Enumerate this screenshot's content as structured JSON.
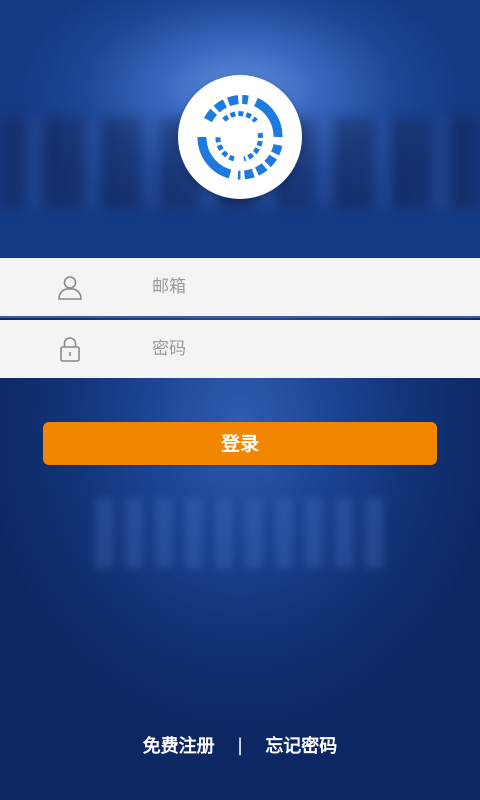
{
  "login_form": {
    "email_placeholder": "邮箱",
    "password_placeholder": "密码",
    "login_label": "登录"
  },
  "footer": {
    "register_label": "免费注册",
    "separator": "|",
    "forgot_label": "忘记密码"
  },
  "icons": {
    "logo": "app-logo",
    "email_field_icon": "user-icon",
    "password_field_icon": "lock-icon"
  },
  "colors": {
    "primary_button": "#f28600",
    "background": "#123478",
    "input_background": "#f4f4f4",
    "logo_blue": "#1f7ae0"
  }
}
